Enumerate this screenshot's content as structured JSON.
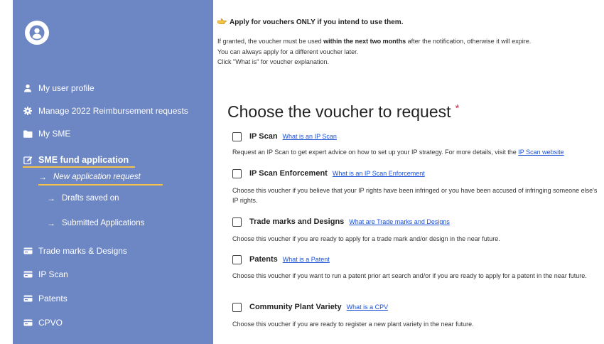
{
  "sidebar": {
    "items": [
      {
        "label": "My user profile",
        "icon": "user-icon"
      },
      {
        "label": "Manage 2022 Reimbursement requests",
        "icon": "gear-icon"
      },
      {
        "label": "My SME",
        "icon": "folder-icon"
      },
      {
        "label": "SME fund application",
        "icon": "edit-icon"
      },
      {
        "label": "Trade marks & Designs",
        "icon": "card-icon"
      },
      {
        "label": "IP Scan",
        "icon": "card-icon"
      },
      {
        "label": "Patents",
        "icon": "card-icon"
      },
      {
        "label": "CPVO",
        "icon": "card-icon"
      }
    ],
    "sub_items": [
      {
        "label": "New application request",
        "arrow": "→"
      },
      {
        "label": "Drafts saved on",
        "arrow": "→"
      },
      {
        "label": "Submitted Applications",
        "arrow": "→"
      }
    ]
  },
  "notice": {
    "title": "Apply for vouchers ONLY if you intend to use them.",
    "line1_pre": "If granted, the voucher must be used",
    "line1_bold": "within the next two months",
    "line1_post": "after the notification, otherwise it will expire.",
    "line2": "You can always apply for a different voucher later.",
    "line3": "Click \"What is\" for voucher explanation."
  },
  "heading": {
    "text": "Choose the voucher to request",
    "required_mark": "*"
  },
  "vouchers": [
    {
      "name": "IP Scan",
      "link": "What is an IP Scan",
      "desc_pre": "Request an IP Scan to get expert advice on how to set up your IP strategy. For more details, visit the",
      "desc_link": "IP Scan website"
    },
    {
      "name": "IP Scan Enforcement",
      "link": "What is an IP Scan Enforcement",
      "desc": "Choose this voucher if you believe that your IP rights have been infringed or you have been accused of infringing someone else's IP rights."
    },
    {
      "name": "Trade marks and Designs",
      "link": "What are Trade marks and Designs",
      "desc": "Choose this voucher if you are ready to apply for a trade mark and/or design in the near future."
    },
    {
      "name": "Patents",
      "link": "What is a Patent",
      "desc": "Choose this voucher if you want to run a patent prior art search and/or if you are ready to apply for a patent in the near future."
    },
    {
      "name": "Community Plant Variety",
      "link": "What is a CPV",
      "desc": "Choose this voucher if you are ready to register a new plant variety in the near future."
    }
  ],
  "colors": {
    "sidebar_bg": "#6d86c4",
    "active_underline": "#f6c24a",
    "link": "#1a4fd6",
    "required": "#d3354a"
  }
}
